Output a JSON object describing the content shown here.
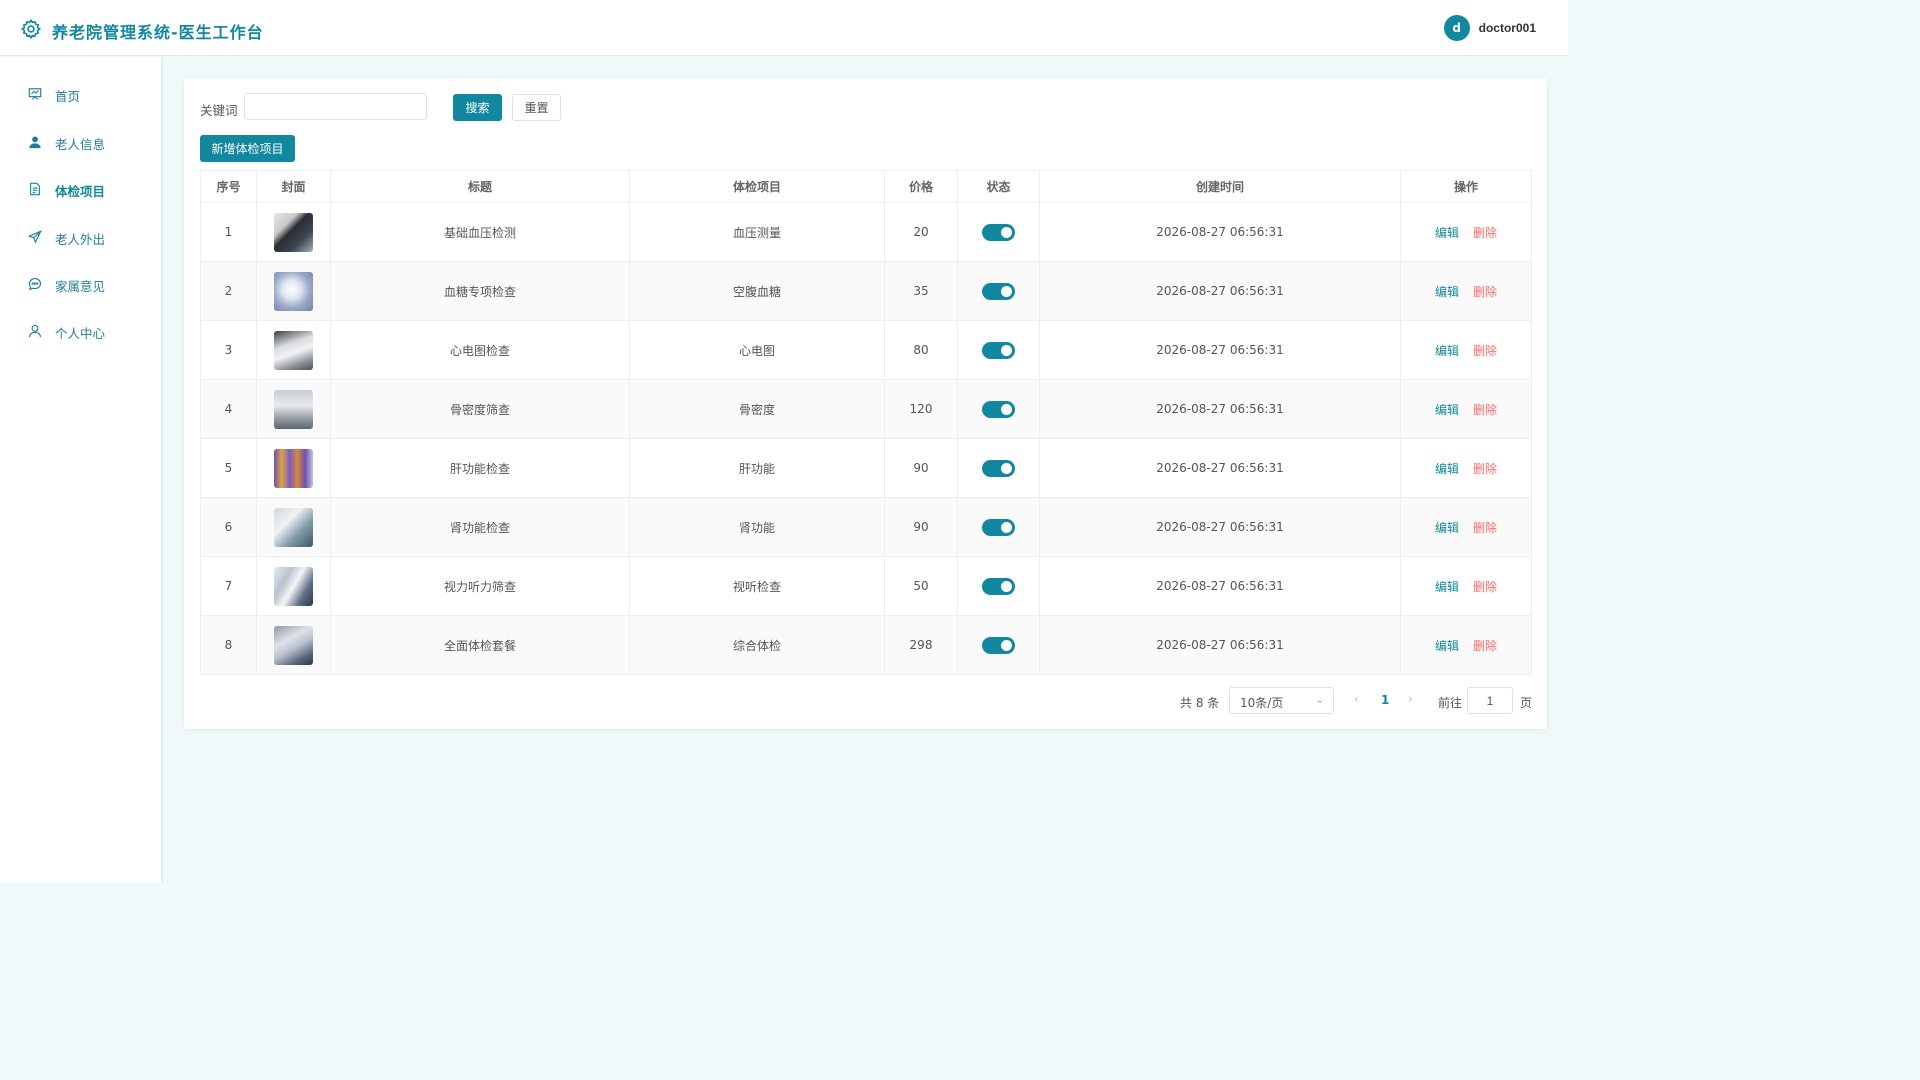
{
  "header": {
    "title": "养老院管理系统-医生工作台",
    "avatar_letter": "d",
    "username": "doctor001",
    "brand_color": "#1287a0"
  },
  "sidebar": {
    "items": [
      {
        "label": "首页",
        "icon": "dashboard-icon",
        "active": false
      },
      {
        "label": "老人信息",
        "icon": "user-icon",
        "active": false
      },
      {
        "label": "体检项目",
        "icon": "document-icon",
        "active": true
      },
      {
        "label": "老人外出",
        "icon": "send-icon",
        "active": false
      },
      {
        "label": "家属意见",
        "icon": "chat-icon",
        "active": false
      },
      {
        "label": "个人中心",
        "icon": "person-icon",
        "active": false
      }
    ]
  },
  "search": {
    "keyword_label": "关键词",
    "keyword_value": "",
    "search_button": "搜索",
    "reset_button": "重置",
    "add_button": "新增体检项目"
  },
  "table": {
    "columns": [
      "序号",
      "封面",
      "标题",
      "体检项目",
      "价格",
      "状态",
      "创建时间",
      "操作"
    ],
    "edit_label": "编辑",
    "delete_label": "删除",
    "rows": [
      {
        "index": "1",
        "title": "基础血压检测",
        "item": "血压测量",
        "price": "20",
        "enabled": true,
        "created": "2026-08-27 06:56:31"
      },
      {
        "index": "2",
        "title": "血糖专项检查",
        "item": "空腹血糖",
        "price": "35",
        "enabled": true,
        "created": "2026-08-27 06:56:31"
      },
      {
        "index": "3",
        "title": "心电图检查",
        "item": "心电图",
        "price": "80",
        "enabled": true,
        "created": "2026-08-27 06:56:31"
      },
      {
        "index": "4",
        "title": "骨密度筛查",
        "item": "骨密度",
        "price": "120",
        "enabled": true,
        "created": "2026-08-27 06:56:31"
      },
      {
        "index": "5",
        "title": "肝功能检查",
        "item": "肝功能",
        "price": "90",
        "enabled": true,
        "created": "2026-08-27 06:56:31"
      },
      {
        "index": "6",
        "title": "肾功能检查",
        "item": "肾功能",
        "price": "90",
        "enabled": true,
        "created": "2026-08-27 06:56:31"
      },
      {
        "index": "7",
        "title": "视力听力筛查",
        "item": "视听检查",
        "price": "50",
        "enabled": true,
        "created": "2026-08-27 06:56:31"
      },
      {
        "index": "8",
        "title": "全面体检套餐",
        "item": "综合体检",
        "price": "298",
        "enabled": true,
        "created": "2026-08-27 06:56:31"
      }
    ]
  },
  "pagination": {
    "total_text": "共 8 条",
    "page_size": "10条/页",
    "current_page": "1",
    "goto_label": "前往",
    "goto_value": "1",
    "page_suffix": "页"
  }
}
